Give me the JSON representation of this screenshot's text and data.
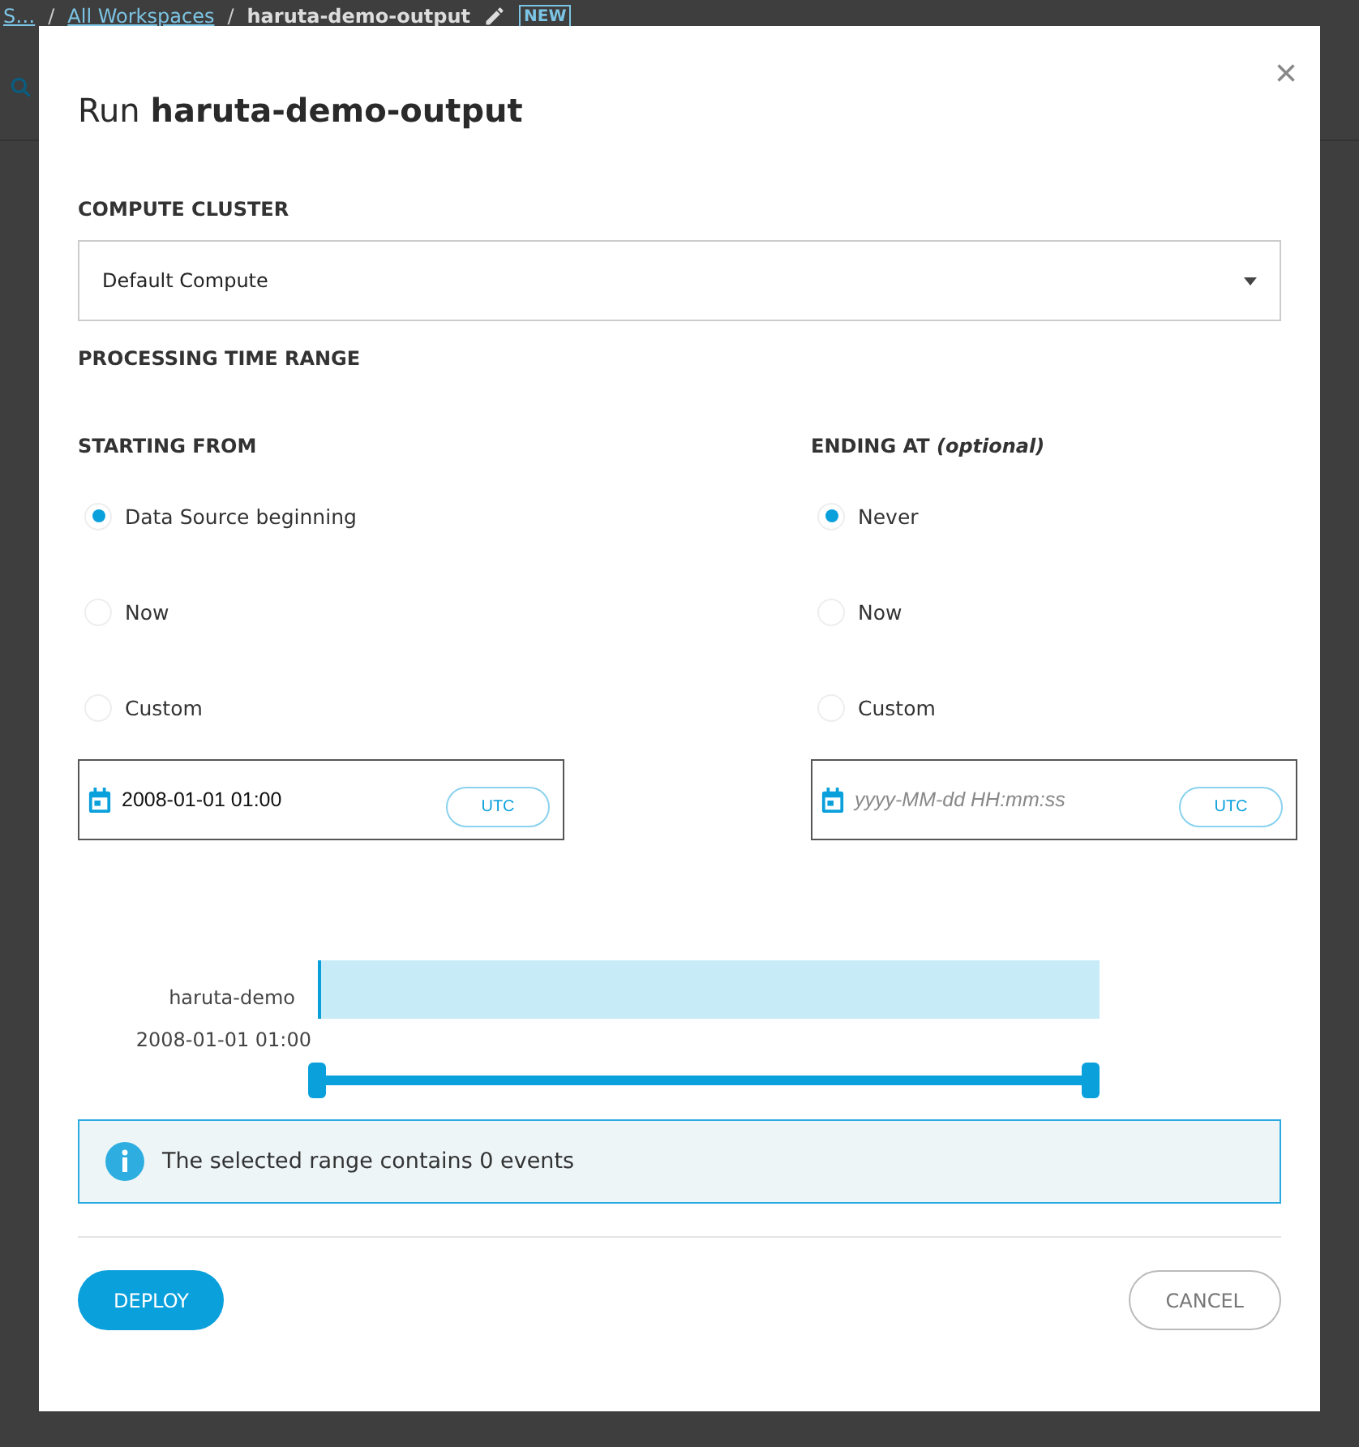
{
  "breadcrumb": {
    "items": [
      {
        "label": "S…"
      },
      {
        "label": "All Workspaces"
      }
    ],
    "separators": [
      "/",
      "/"
    ],
    "current": "haruta-demo-output",
    "badge": "NEW"
  },
  "dialog": {
    "title": "Run **haruta-demo-output**",
    "close": "×",
    "cluster": {
      "label": "COMPUTE CLUSTER",
      "value": "Default Compute"
    },
    "time_range_heading": "PROCESSING TIME RANGE",
    "start": {
      "label": "STARTING FROM",
      "options": [
        {
          "label": "Data Source beginning",
          "selected": true
        },
        {
          "label": "Now",
          "selected": false
        },
        {
          "label": "Custom",
          "selected": false
        }
      ],
      "field": {
        "value": "2008-01-01 01:00",
        "tz": "UTC"
      }
    },
    "end": {
      "label": "ENDING AT *(optional)*",
      "options": [
        {
          "label": "Never",
          "selected": true
        },
        {
          "label": "Now",
          "selected": false
        },
        {
          "label": "Custom",
          "selected": false
        }
      ],
      "field": {
        "placeholder": "yyyy-MM-dd HH:mm:ss",
        "tz": "UTC"
      }
    },
    "timeline": {
      "source": "haruta-demo",
      "start_label": "2008-01-01 01:00",
      "slider": {
        "level": 1
      }
    },
    "info": "The selected range contains 0 events",
    "buttons": [
      {
        "label": "DEPLOY",
        "kind": "primary"
      },
      {
        "label": "CANCEL",
        "kind": "secondary"
      }
    ]
  }
}
